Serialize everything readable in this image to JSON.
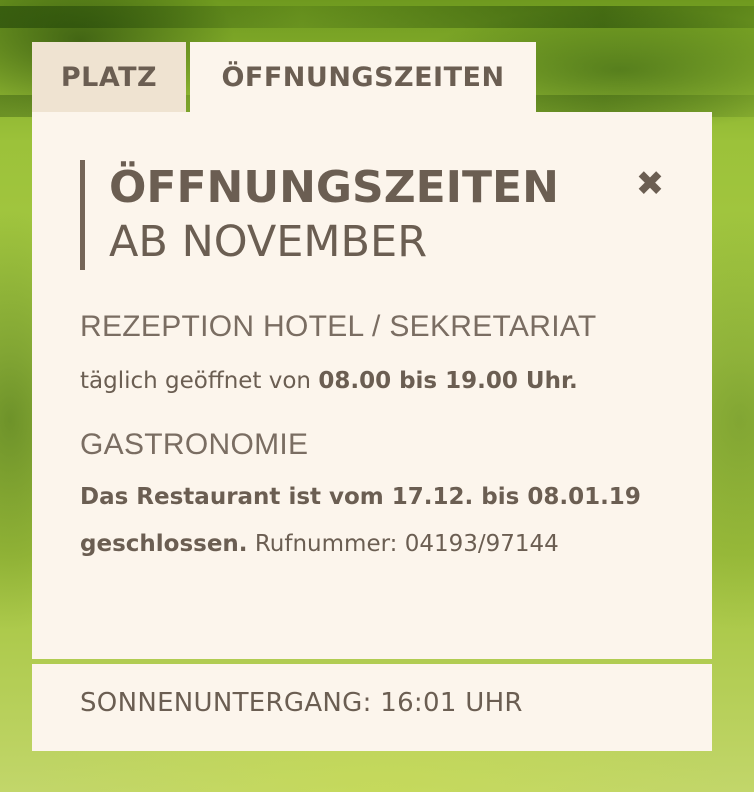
{
  "tabs": [
    {
      "label": "PLATZ"
    },
    {
      "label": "ÖFFNUNGSZEITEN"
    }
  ],
  "panel": {
    "title_line1": "ÖFFNUNGSZEITEN",
    "title_line2": "AB NOVEMBER",
    "close_icon": "close-icon",
    "sections": [
      {
        "title": "REZEPTION HOTEL / SEKRETARIAT",
        "text_normal": "täglich geöffnet von ",
        "text_bold": "08.00 bis 19.00 Uhr."
      },
      {
        "title": "GASTRONOMIE",
        "text_bold": "Das Restaurant ist vom 17.12. bis 08.01.19 geschlossen.",
        "text_normal": " Rufnummer: 04193/97144"
      }
    ]
  },
  "footer": {
    "sunset": "SONNENUNTERGANG: 16:01 UHR"
  },
  "colors": {
    "panel_bg": "#fcf5ec",
    "inactive_tab_bg": "#efe3d1",
    "text": "#6b5e52"
  }
}
